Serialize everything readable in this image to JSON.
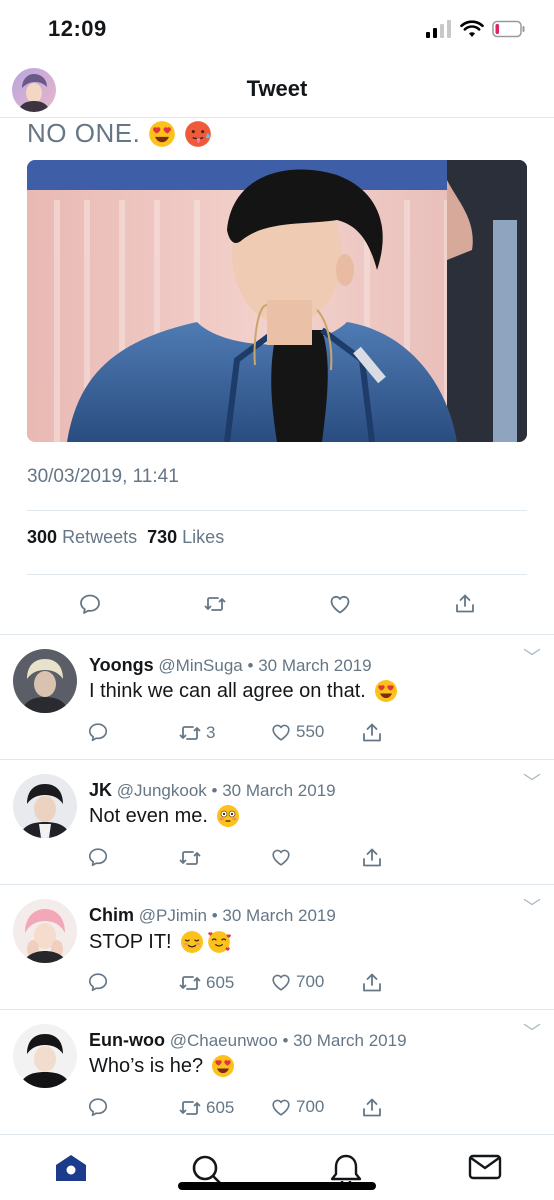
{
  "status_bar": {
    "time": "12:09"
  },
  "nav": {
    "title": "Tweet"
  },
  "tweet": {
    "text": "NO ONE.",
    "date": "30/03/2019, 11:41",
    "retweet_count": "300",
    "retweet_label": "Retweets",
    "like_count": "730",
    "like_label": "Likes"
  },
  "replies": [
    {
      "name": "Yoongs",
      "handle": "@MinSuga",
      "date": "30 March 2019",
      "text": "I think we can all agree on that.",
      "retweets": "3",
      "likes": "550"
    },
    {
      "name": "JK",
      "handle": "@Jungkook",
      "date": "30 March 2019",
      "text": "Not even me.",
      "retweets": "",
      "likes": ""
    },
    {
      "name": "Chim",
      "handle": "@PJimin",
      "date": "30 March 2019",
      "text": "STOP IT!",
      "retweets": "605",
      "likes": "700"
    },
    {
      "name": "Eun-woo",
      "handle": "@Chaeunwoo",
      "date": "30 March 2019",
      "text": "Who’s is he?",
      "retweets": "605",
      "likes": "700"
    }
  ],
  "separator": "•",
  "colors": {
    "accent": "#1da1f2",
    "tab_active": "#1d3b8c",
    "muted": "#657786",
    "battery_low": "#e0245e"
  },
  "icons": [
    "signal-icon",
    "wifi-icon",
    "battery-icon",
    "reply-icon",
    "retweet-icon",
    "like-icon",
    "share-icon",
    "chevron-down-icon",
    "home-icon",
    "search-icon",
    "notifications-icon",
    "messages-icon"
  ]
}
